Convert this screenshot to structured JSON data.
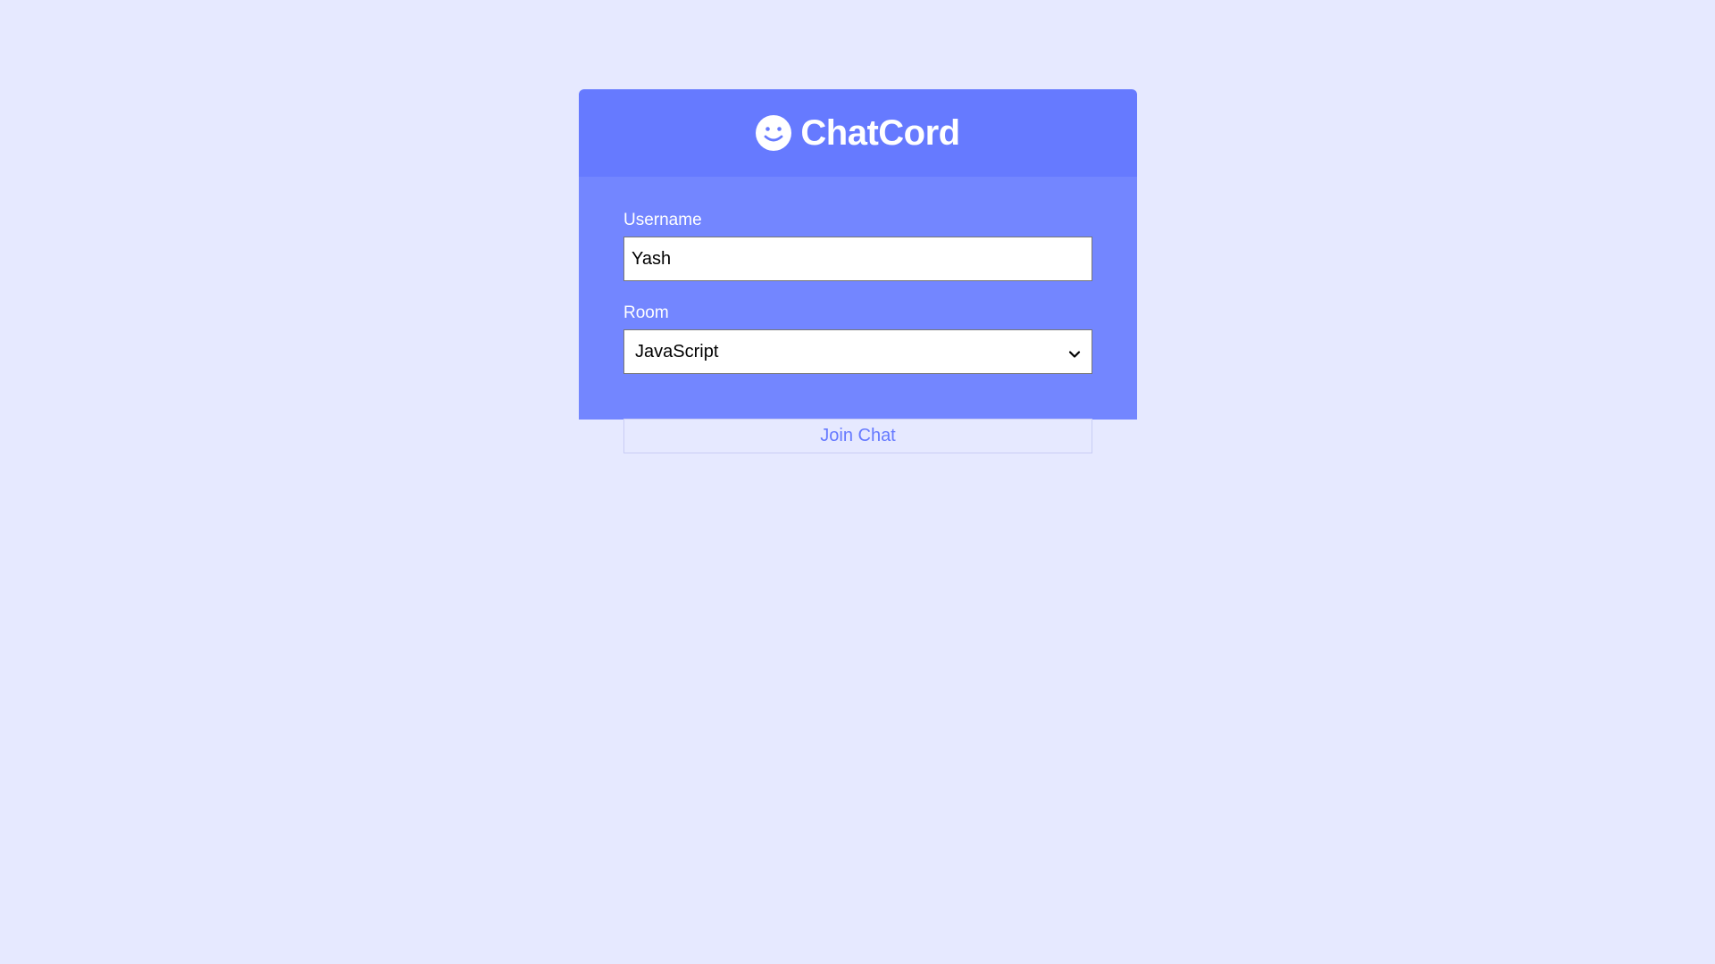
{
  "app": {
    "title": "ChatCord",
    "logo_icon": "smile-icon"
  },
  "form": {
    "username": {
      "label": "Username",
      "value": "Yash"
    },
    "room": {
      "label": "Room",
      "selected": "JavaScript"
    },
    "submit_label": "Join Chat"
  },
  "colors": {
    "background": "#e6e9ff",
    "header": "#667aff",
    "panel": "#7386ff",
    "button_text": "#667aff"
  }
}
